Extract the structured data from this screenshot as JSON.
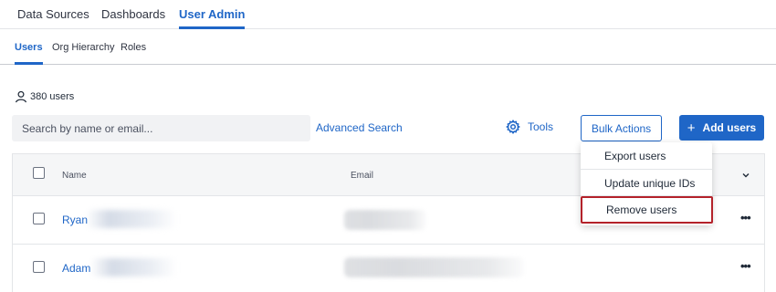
{
  "top_nav": {
    "tabs": [
      {
        "label": "Data Sources"
      },
      {
        "label": "Dashboards"
      },
      {
        "label": "User Admin",
        "active": true
      }
    ]
  },
  "sub_nav": {
    "tabs": [
      {
        "label": "Users",
        "active": true
      },
      {
        "label": "Org Hierarchy"
      },
      {
        "label": "Roles"
      }
    ]
  },
  "user_count": {
    "text": "380 users",
    "icon": "user-icon"
  },
  "search": {
    "placeholder": "Search by name or email...",
    "value": ""
  },
  "advanced_search_label": "Advanced Search",
  "tools_label": "Tools",
  "bulk_actions_label": "Bulk Actions",
  "add_users_label": "Add users",
  "table": {
    "columns": [
      "Name",
      "Email"
    ],
    "rows": [
      {
        "name": "Ryan"
      },
      {
        "name": "Adam"
      }
    ],
    "row_menu_glyph": "•••"
  },
  "bulk_menu": {
    "items": [
      "Export users",
      "Update unique IDs",
      "Remove users"
    ],
    "highlighted": "Remove users"
  },
  "colors": {
    "accent": "#1f66c7",
    "highlight_border": "#b4222a"
  }
}
